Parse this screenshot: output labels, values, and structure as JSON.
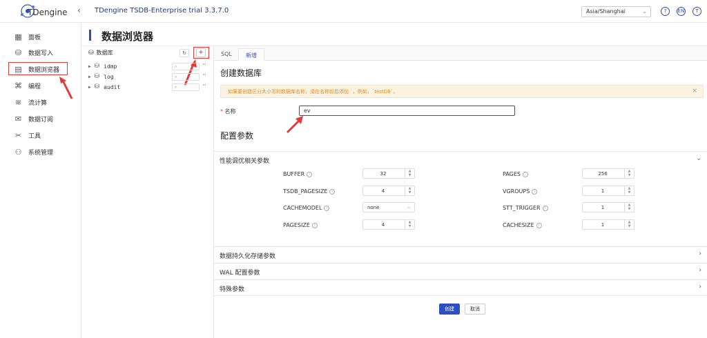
{
  "header": {
    "logo_text": "TDengine",
    "app_title": "TDengine TSDB-Enterprise trial 3.3.7.0",
    "collapse_icon": "chevron-left-icon",
    "timezone": "Asia/Shanghai",
    "help_label": "?",
    "lang_label": "EN",
    "user_label": "T"
  },
  "sidebar": {
    "items": [
      {
        "label": "面板",
        "icon": "dashboard-icon"
      },
      {
        "label": "数据写入",
        "icon": "data-in-icon"
      },
      {
        "label": "数据浏览器",
        "icon": "browser-icon"
      },
      {
        "label": "编程",
        "icon": "code-icon"
      },
      {
        "label": "流计算",
        "icon": "stream-icon"
      },
      {
        "label": "数据订阅",
        "icon": "subscribe-icon"
      },
      {
        "label": "工具",
        "icon": "tools-icon"
      },
      {
        "label": "系统管理",
        "icon": "admin-icon"
      }
    ],
    "active_index": 2
  },
  "page": {
    "title": "数据浏览器"
  },
  "tree": {
    "header": "数据库",
    "add_label": "+",
    "databases": [
      {
        "name": "idmp"
      },
      {
        "name": "log"
      },
      {
        "name": "audit"
      }
    ],
    "more_label": "···"
  },
  "tabs": [
    {
      "label": "SQL",
      "active": false
    },
    {
      "label": "新增",
      "active": true
    }
  ],
  "form": {
    "title": "创建数据库",
    "alert": "如果要创建区分大小写的数据库名称，请在名称前后添加 `，例如，`testDB`。",
    "name_label": "名称",
    "name_required_mark": "*",
    "name_value": "ev",
    "config_title": "配置参数",
    "perf_section": "性能调优相关参数",
    "params_left": [
      {
        "label": "BUFFER",
        "value": "32",
        "kind": "number"
      },
      {
        "label": "TSDB_PAGESIZE",
        "value": "4",
        "kind": "number"
      },
      {
        "label": "CACHEMODEL",
        "value": "none",
        "kind": "select"
      },
      {
        "label": "PAGESIZE",
        "value": "4",
        "kind": "number"
      }
    ],
    "params_right": [
      {
        "label": "PAGES",
        "value": "256",
        "kind": "number"
      },
      {
        "label": "VGROUPS",
        "value": "1",
        "kind": "number"
      },
      {
        "label": "STT_TRIGGER",
        "value": "1",
        "kind": "number"
      },
      {
        "label": "CACHESIZE",
        "value": "1",
        "kind": "number"
      }
    ],
    "sections_collapsed": [
      {
        "label": "数据持久化存储参数"
      },
      {
        "label": "WAL 配置参数"
      },
      {
        "label": "特殊参数"
      }
    ],
    "create_label": "创建",
    "cancel_label": "取消"
  },
  "colors": {
    "accent": "#2d4ec0",
    "highlight": "#e53935",
    "alert_bg": "#fdf3e3",
    "alert_text": "#e88a1a"
  }
}
